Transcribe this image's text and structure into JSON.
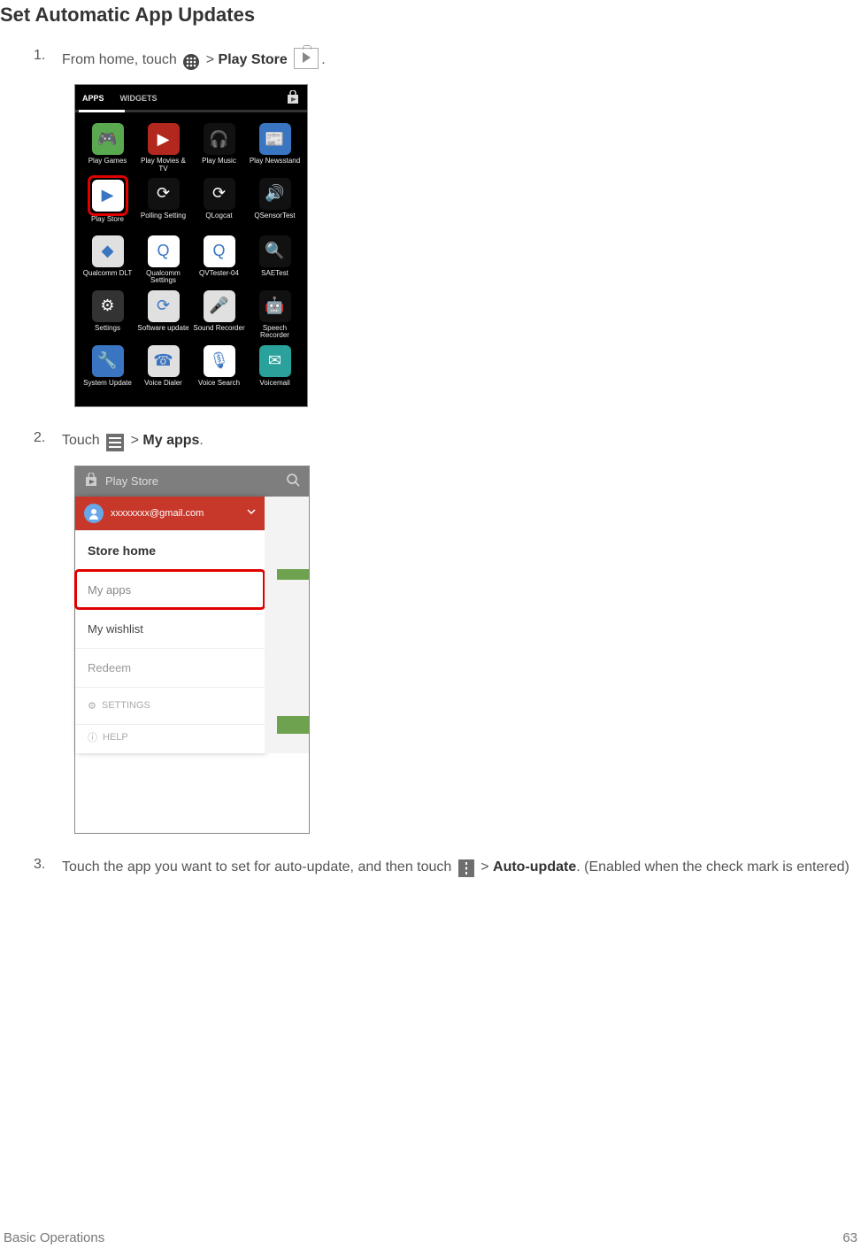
{
  "heading": "Set Automatic App Updates",
  "steps": {
    "s1": {
      "num": "1.",
      "t1": "From home, touch ",
      "sep": " > ",
      "bold": "Play Store",
      "t2": "."
    },
    "s2": {
      "num": "2.",
      "t1": "Touch ",
      "sep": " > ",
      "bold": "My apps",
      "t2": "."
    },
    "s3": {
      "num": "3.",
      "t1": "Touch the app you want to set for auto-update, and then touch ",
      "sep": " > ",
      "bold": "Auto-update",
      "t2": ". (Enabled when the check mark is entered)"
    }
  },
  "ss1": {
    "tabs": {
      "apps": "APPS",
      "widgets": "WIDGETS"
    },
    "grid": [
      {
        "label": "Play Games",
        "bg": "#5aa84f",
        "glyph": "🎮"
      },
      {
        "label": "Play Movies & TV",
        "bg": "#b2281e",
        "glyph": "▶"
      },
      {
        "label": "Play Music",
        "bg": "#111",
        "glyph": "🎧"
      },
      {
        "label": "Play Newsstand",
        "bg": "#3a75c1",
        "glyph": "📰"
      },
      {
        "label": "Play Store",
        "bg": "#fff",
        "glyph": "▶",
        "hl": true
      },
      {
        "label": "Polling Setting",
        "bg": "#111",
        "glyph": "⟳"
      },
      {
        "label": "QLogcat",
        "bg": "#111",
        "glyph": "⟳"
      },
      {
        "label": "QSensorTest",
        "bg": "#111",
        "glyph": "🔊"
      },
      {
        "label": "Qualcomm DLT",
        "bg": "#e0e0e0",
        "glyph": "◆"
      },
      {
        "label": "Qualcomm Settings",
        "bg": "#fff",
        "glyph": "Q"
      },
      {
        "label": "QVTester-04",
        "bg": "#fff",
        "glyph": "Q"
      },
      {
        "label": "SAETest",
        "bg": "#111",
        "glyph": "🔍"
      },
      {
        "label": "Settings",
        "bg": "#333",
        "glyph": "⚙"
      },
      {
        "label": "Software update",
        "bg": "#e0e0e0",
        "glyph": "⟳"
      },
      {
        "label": "Sound Recorder",
        "bg": "#e0e0e0",
        "glyph": "🎤"
      },
      {
        "label": "Speech Recorder",
        "bg": "#111",
        "glyph": "🤖"
      },
      {
        "label": "System Update",
        "bg": "#3a75c1",
        "glyph": "🔧"
      },
      {
        "label": "Voice Dialer",
        "bg": "#e0e0e0",
        "glyph": "☎"
      },
      {
        "label": "Voice Search",
        "bg": "#fff",
        "glyph": "🎙"
      },
      {
        "label": "Voicemail",
        "bg": "#2aa19a",
        "glyph": "✉"
      }
    ]
  },
  "ss2": {
    "title": "Play Store",
    "account": "xxxxxxxx@gmail.com",
    "items": {
      "store_home": "Store home",
      "my_apps": "My apps",
      "my_wishlist": "My wishlist",
      "redeem": "Redeem",
      "settings": "SETTINGS",
      "help": "HELP"
    }
  },
  "footer": {
    "section": "Basic Operations",
    "page": "63"
  }
}
